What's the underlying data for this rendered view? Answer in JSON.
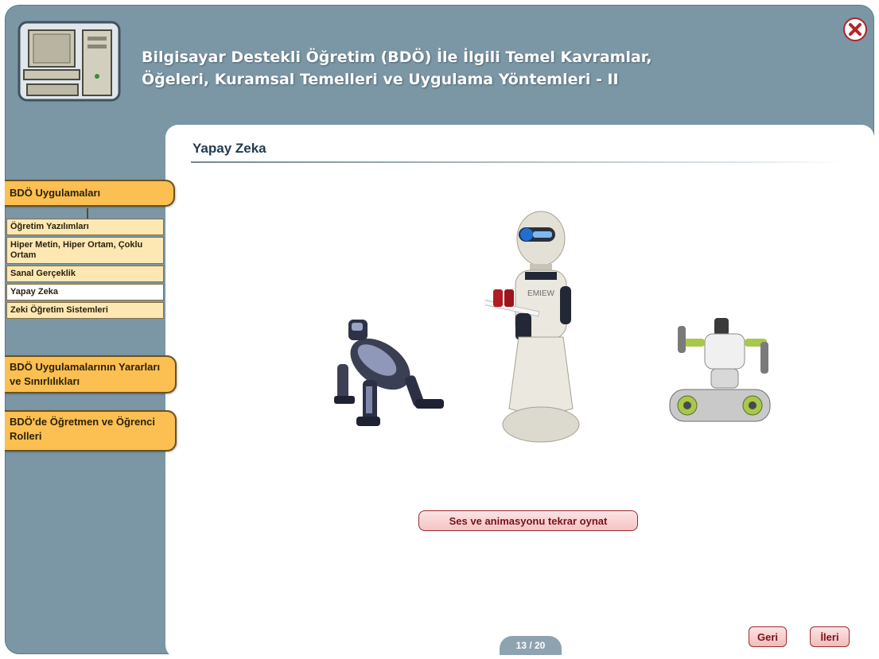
{
  "header": {
    "title_line1": "Bilgisayar Destekli Öğretim (BDÖ) İle İlgili Temel Kavramlar,",
    "title_line2": "Öğeleri, Kuramsal Temelleri ve Uygulama Yöntemleri - II",
    "close_icon": "close-icon",
    "logo_icon": "computer-icon"
  },
  "sidebar": {
    "section1": "BDÖ Uygulamaları",
    "items": [
      {
        "label": "Öğretim Yazılımları"
      },
      {
        "label": "Hiper Metin, Hiper Ortam, Çoklu Ortam"
      },
      {
        "label": "Sanal Gerçeklik"
      },
      {
        "label": "Yapay Zeka",
        "active": true
      },
      {
        "label": "Zeki Öğretim Sistemleri"
      }
    ],
    "section2": "BDÖ Uygulamalarının Yararları ve Sınırlılıkları",
    "section3": "BDÖ'de Öğretmen ve Öğrenci Rolleri"
  },
  "content": {
    "title": "Yapay Zeka",
    "replay_label": "Ses ve animasyonu tekrar oynat",
    "robot_badge": "EMIEW"
  },
  "footer": {
    "page": "13 / 20",
    "back_label": "Geri",
    "next_label": "İleri"
  },
  "colors": {
    "frame": "#7b97a6",
    "nav_accent": "#fbbf52",
    "button_accent": "#9b2a30"
  }
}
